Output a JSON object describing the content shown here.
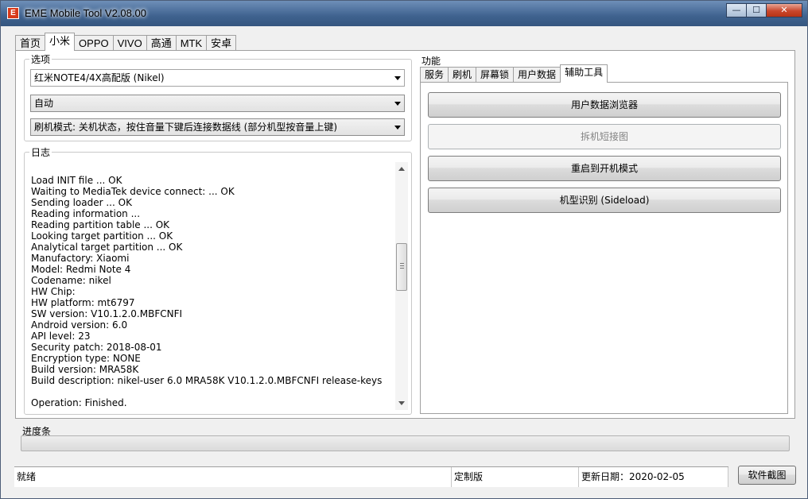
{
  "window": {
    "title": "EME Mobile Tool V2.08.00",
    "icon_letter": "E",
    "minimize_glyph": "—",
    "maximize_glyph": "☐",
    "close_glyph": "✕"
  },
  "top_tabs": [
    {
      "label": "首页"
    },
    {
      "label": "小米",
      "active": true
    },
    {
      "label": "OPPO"
    },
    {
      "label": "VIVO"
    },
    {
      "label": "高通"
    },
    {
      "label": "MTK"
    },
    {
      "label": "安卓"
    }
  ],
  "options": {
    "title": "选项",
    "model_select": "红米NOTE4/4X高配版 (Nikel)",
    "mode_select": "自动",
    "flash_mode_select": "刷机模式: 关机状态，按住音量下键后连接数据线 (部分机型按音量上键)"
  },
  "log": {
    "title": "日志",
    "lines": [
      "",
      "Load INIT file ... OK",
      "Waiting to MediaTek device connect: ... OK",
      "Sending loader ... OK",
      "Reading information ...",
      "Reading partition table ... OK",
      "Looking target partition ... OK",
      "Analytical target partition ... OK",
      "Manufactory: Xiaomi",
      "Model: Redmi Note 4",
      "Codename: nikel",
      "HW Chip:",
      "HW platform: mt6797",
      "SW version: V10.1.2.0.MBFCNFI",
      "Android version: 6.0",
      "API level: 23",
      "Security patch: 2018-08-01",
      "Encryption type: NONE",
      "Build version: MRA58K",
      "Build description: nikel-user 6.0 MRA58K V10.1.2.0.MBFCNFI release-keys",
      "",
      "Operation: Finished."
    ]
  },
  "functions": {
    "title": "功能",
    "tabs": [
      {
        "label": "服务"
      },
      {
        "label": "刷机"
      },
      {
        "label": "屏幕锁"
      },
      {
        "label": "用户数据"
      },
      {
        "label": "辅助工具",
        "active": true
      }
    ],
    "buttons": [
      {
        "label": "用户数据浏览器",
        "enabled": true
      },
      {
        "label": "拆机短接图",
        "enabled": false
      },
      {
        "label": "重启到开机模式",
        "enabled": true
      },
      {
        "label": "机型识别 (Sideload)",
        "enabled": true
      }
    ]
  },
  "progress": {
    "label": "进度条",
    "value": 0
  },
  "status_bar": {
    "state": "就绪",
    "edition": "定制版",
    "update_date": "更新日期：2020-02-05"
  },
  "screenshot_button": "软件截图"
}
